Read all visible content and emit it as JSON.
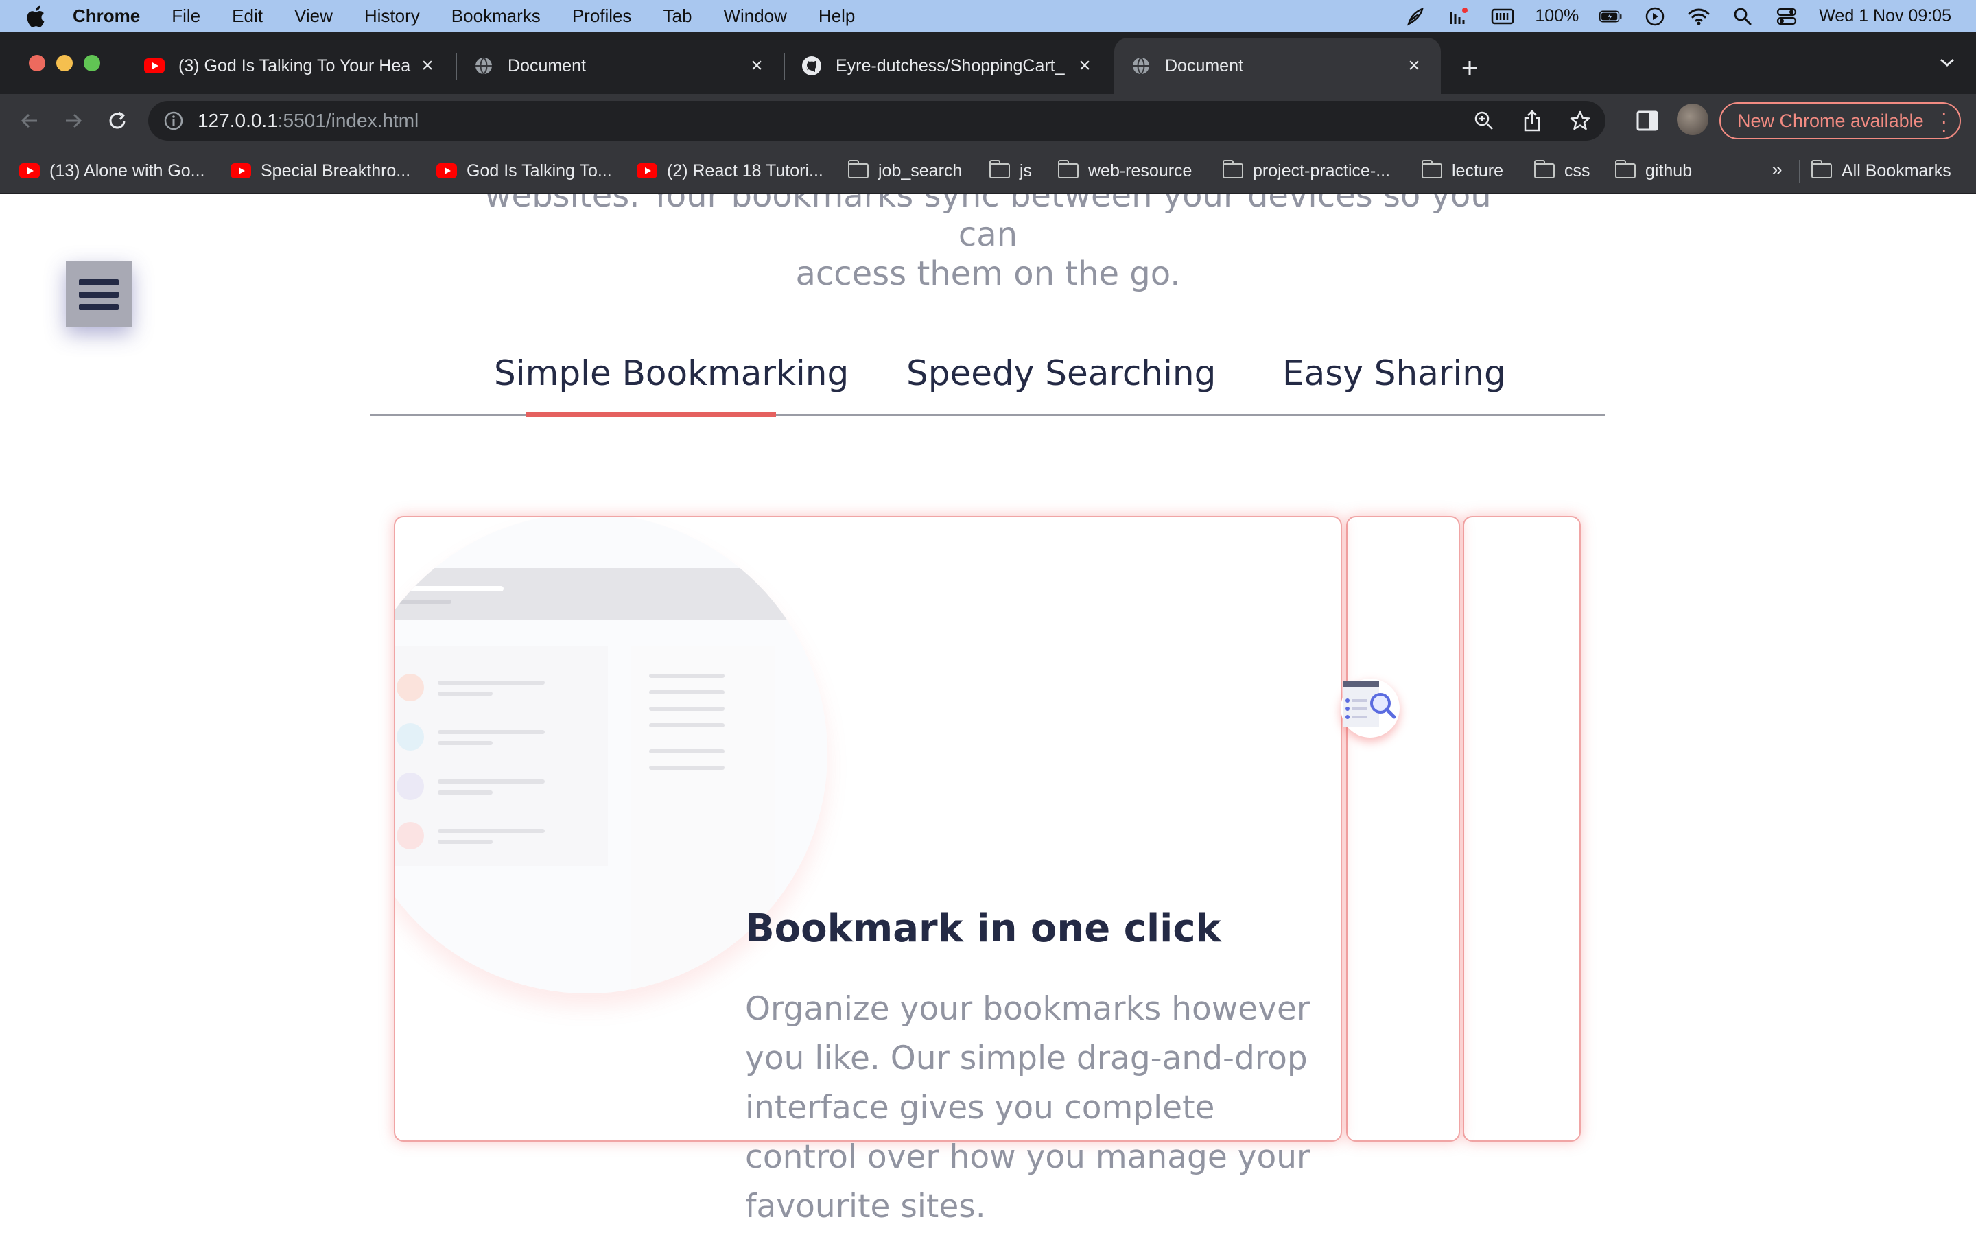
{
  "menubar": {
    "app": "Chrome",
    "items": [
      "File",
      "Edit",
      "View",
      "History",
      "Bookmarks",
      "Profiles",
      "Tab",
      "Window",
      "Help"
    ],
    "battery": "100%",
    "datetime": "Wed 1 Nov  09:05"
  },
  "tabs": [
    {
      "title": "(3) God Is Talking To Your Hea",
      "favicon": "youtube-icon"
    },
    {
      "title": "Document",
      "favicon": "globe-icon"
    },
    {
      "title": "Eyre-dutchess/ShoppingCart_",
      "favicon": "github-icon"
    },
    {
      "title": "Document",
      "favicon": "globe-icon",
      "active": true
    }
  ],
  "omnibox": {
    "host": "127.0.0.1",
    "path": ":5501/index.html"
  },
  "toolbar": {
    "update_label": "New Chrome available"
  },
  "bookmarks": [
    {
      "label": "(13) Alone with Go...",
      "icon": "youtube-icon"
    },
    {
      "label": "Special Breakthro...",
      "icon": "youtube-icon"
    },
    {
      "label": "God Is Talking To...",
      "icon": "youtube-icon"
    },
    {
      "label": "(2) React 18 Tutori...",
      "icon": "youtube-icon"
    },
    {
      "label": "job_search",
      "icon": "folder-icon"
    },
    {
      "label": "js",
      "icon": "folder-icon"
    },
    {
      "label": "web-resource",
      "icon": "folder-icon"
    },
    {
      "label": "project-practice-...",
      "icon": "folder-icon"
    },
    {
      "label": "lecture",
      "icon": "folder-icon"
    },
    {
      "label": "css",
      "icon": "folder-icon"
    },
    {
      "label": "github",
      "icon": "folder-icon"
    }
  ],
  "bookmarks_more": "»",
  "all_bookmarks": "All Bookmarks",
  "page": {
    "intro_line1": "websites. Your bookmarks sync between your devices so you can",
    "intro_line2": "access them on the go.",
    "feature_tabs": [
      "Simple Bookmarking",
      "Speedy Searching",
      "Easy Sharing"
    ],
    "active_tab": "Simple Bookmarking",
    "feature_title": "Bookmark in one click",
    "feature_text": "Organize your bookmarks however you like. Our simple drag-and-drop interface gives you complete control over how you manage your favourite sites.",
    "accent_color": "#e5615f",
    "heading_color": "#242a45",
    "text_color": "#9194a1"
  }
}
